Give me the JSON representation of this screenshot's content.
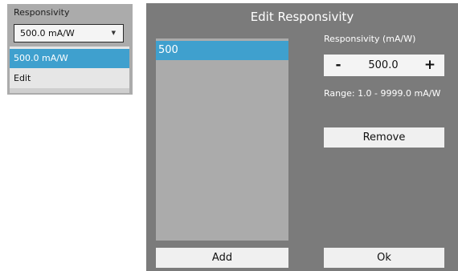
{
  "combo": {
    "label": "Responsivity",
    "value": "500.0 mA/W",
    "arrow_icon": "chevron-down-icon",
    "options": [
      {
        "label": "500.0 mA/W",
        "selected": true
      },
      {
        "label": "Edit",
        "selected": false
      }
    ]
  },
  "dialog": {
    "title": "Edit Responsivity",
    "list": {
      "items": [
        "500"
      ],
      "selected_index": 0
    },
    "add_label": "Add",
    "field_label": "Responsivity (mA/W)",
    "stepper": {
      "minus": "-",
      "value": "500.0",
      "plus": "+"
    },
    "range": "Range: 1.0 - 9999.0 mA/W",
    "remove_label": "Remove",
    "ok_label": "Ok"
  },
  "colors": {
    "accent": "#3fa0ce",
    "dialog_bg": "#7b7b7b",
    "panel_bg": "#ababab",
    "button_bg": "#f0f0f0"
  }
}
